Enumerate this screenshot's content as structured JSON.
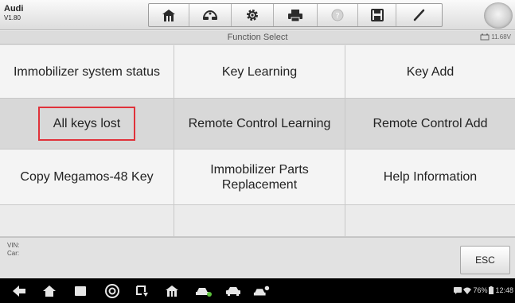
{
  "header": {
    "make": "Audi",
    "version": "V1.80",
    "toolbar_icons": [
      "home-icon",
      "vehicle-swap-icon",
      "gear-icon",
      "printer-icon",
      "help-icon",
      "save-icon",
      "pen-icon"
    ]
  },
  "titlebar": {
    "title": "Function Select",
    "battery_voltage": "11.68V"
  },
  "functions": [
    {
      "label": "Immobilizer system status"
    },
    {
      "label": "Key Learning"
    },
    {
      "label": "Key Add"
    },
    {
      "label": "All keys lost",
      "highlighted": true
    },
    {
      "label": "Remote Control Learning"
    },
    {
      "label": "Remote Control Add"
    },
    {
      "label": "Copy Megamos-48 Key"
    },
    {
      "label": "Immobilizer Parts Replacement"
    },
    {
      "label": "Help Information"
    }
  ],
  "vehicle_info": {
    "vin_label": "VIN:",
    "car_label": "Car:"
  },
  "buttons": {
    "esc": "ESC"
  },
  "status_bar": {
    "battery": "76%",
    "time": "12:48"
  },
  "colors": {
    "highlight": "#e0323a",
    "cell_light": "#f4f4f4",
    "cell_dark": "#d8d8d8"
  }
}
